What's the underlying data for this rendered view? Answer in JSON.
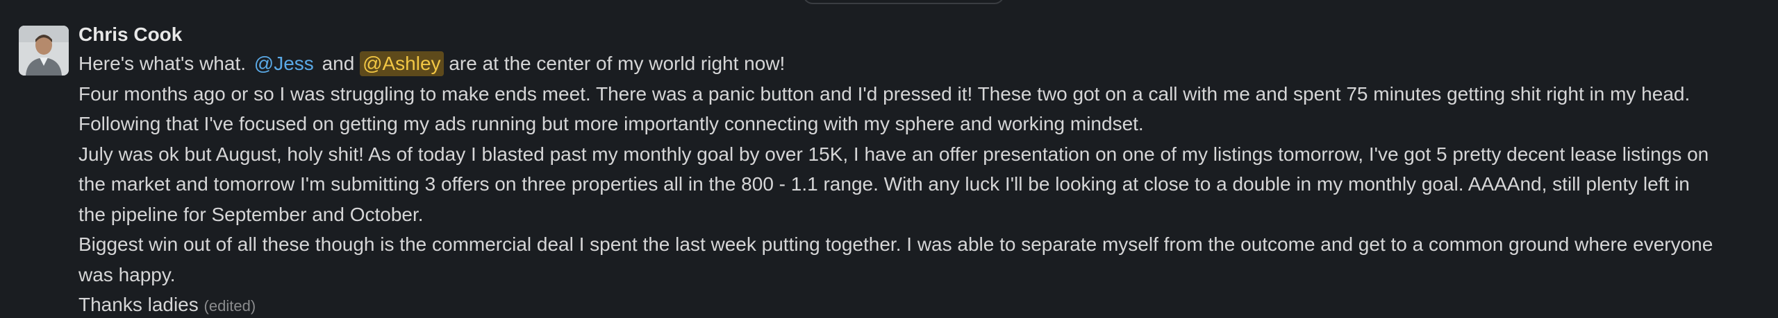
{
  "message": {
    "author": "Chris Cook",
    "avatar_icon": "person-photo-avatar",
    "line1": {
      "before": "Here's what's what. ",
      "mention1": "@Jess",
      "between": " and ",
      "mention2": "@Ashley",
      "after": " are at the center of my world right now!"
    },
    "line2": "Four months ago or so I was struggling to make ends meet.  There was a panic button and I'd pressed it!  These two got on a call with me and spent 75 minutes getting shit right in my head.",
    "line3": "Following that I've focused on getting my ads running but more importantly connecting with my sphere and working mindset.",
    "line4": "July was ok but August, holy shit!  As of today I blasted past my monthly goal by over 15K, I have an offer presentation on one of my listings tomorrow, I've got 5 pretty decent lease listings on",
    "line5": "the market and tomorrow I'm submitting 3 offers on three properties all in the 800 - 1.1 range.  With any luck I'll be looking at close to a double in my monthly goal.  AAAAnd, still plenty left in",
    "line6": "the pipeline for September and October.",
    "line7": "Biggest win out of all these though is the commercial deal I spent the last week putting together.  I was able to separate myself from the outcome and get to a common ground where everyone",
    "line8": "was happy.",
    "line9": "Thanks ladies",
    "edited_label": "(edited)"
  },
  "colors": {
    "background": "#1a1d21",
    "text": "#d6d6d7",
    "mention_jess": "#5aa9e6",
    "mention_ashley_text": "#f2c744",
    "mention_ashley_bg": "#5e4a1b",
    "muted": "#8a8b8d"
  }
}
